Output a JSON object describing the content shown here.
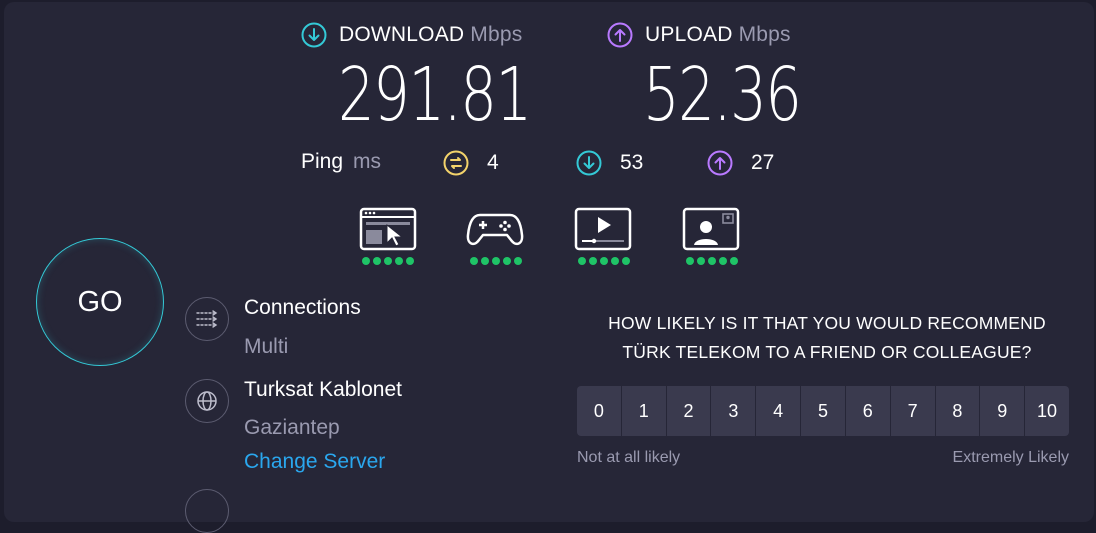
{
  "download": {
    "label": "DOWNLOAD",
    "unit": "Mbps",
    "value": "291.81"
  },
  "upload": {
    "label": "UPLOAD",
    "unit": "Mbps",
    "value": "52.36"
  },
  "ping": {
    "label": "Ping",
    "unit": "ms",
    "idle": "4",
    "download": "53",
    "upload": "27"
  },
  "use_cases": [
    {
      "icon": "web-browsing-icon",
      "rating_dots": 5
    },
    {
      "icon": "gaming-controller-icon",
      "rating_dots": 5
    },
    {
      "icon": "video-streaming-icon",
      "rating_dots": 5
    },
    {
      "icon": "video-call-icon",
      "rating_dots": 5
    }
  ],
  "go_button": "GO",
  "connections": {
    "title": "Connections",
    "value": "Multi"
  },
  "server": {
    "name": "Turksat Kablonet",
    "location": "Gaziantep",
    "change_link": "Change Server"
  },
  "survey": {
    "question_line1": "HOW LIKELY IS IT THAT YOU WOULD RECOMMEND",
    "question_line2": "TÜRK TELEKOM TO A FRIEND OR COLLEAGUE?",
    "scale": [
      "0",
      "1",
      "2",
      "3",
      "4",
      "5",
      "6",
      "7",
      "8",
      "9",
      "10"
    ],
    "low_label": "Not at all likely",
    "high_label": "Extremely Likely"
  },
  "colors": {
    "download_accent": "#34c9d6",
    "upload_accent": "#b97aff",
    "idle_accent": "#f3d36b",
    "rating_green": "#1fc467",
    "link": "#2aa7ee"
  }
}
